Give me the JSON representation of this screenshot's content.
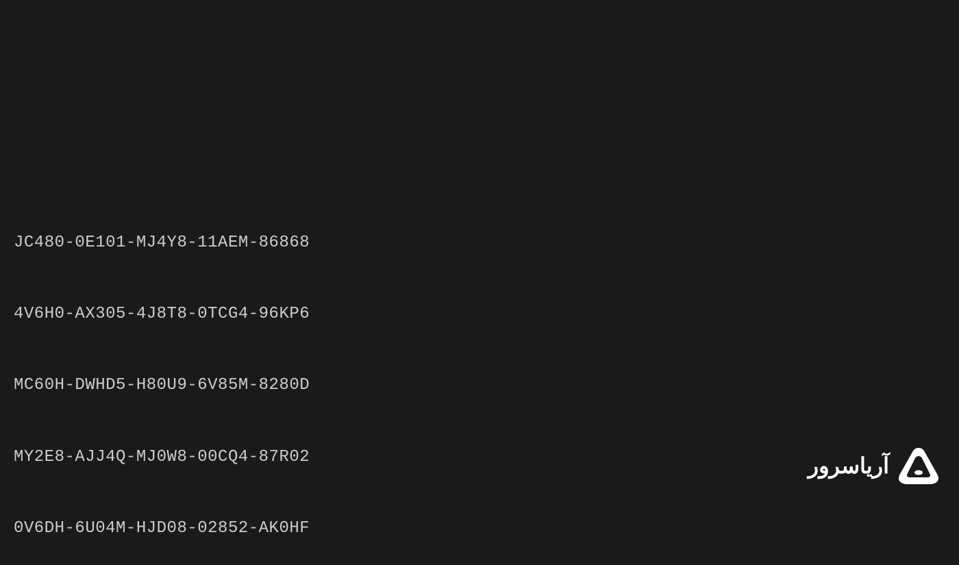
{
  "codes": {
    "line1": "JC480-0E101-MJ4Y8-11AEM-86868",
    "line2": "4V6H0-AX305-4J8T8-0TCG4-96KP6",
    "line3": "MC60H-DWHD5-H80U9-6V85M-8280D",
    "line4": "MY2E8-AJJ4Q-MJ0W8-00CQ4-87R02",
    "line5": "0V6DH-6U04M-HJD08-02852-AK0HF"
  },
  "watermark": {
    "text": "آریاسرور"
  }
}
